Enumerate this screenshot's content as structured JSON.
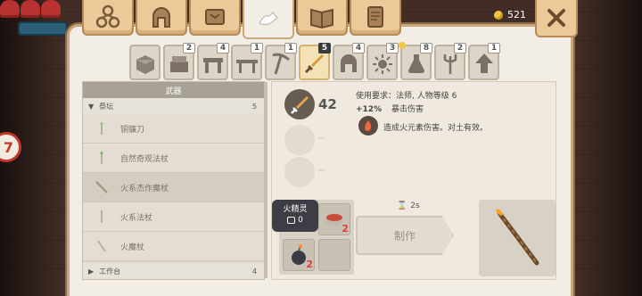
{
  "hud": {
    "badge_text": "7"
  },
  "top_tabs": [
    {
      "id": "structures",
      "icon": "structures-icon",
      "active": false
    },
    {
      "id": "helmet",
      "icon": "helmet-icon",
      "active": false
    },
    {
      "id": "storage",
      "icon": "treasure-map-icon",
      "active": false
    },
    {
      "id": "crafting",
      "icon": "crafting-hands-icon",
      "active": true
    },
    {
      "id": "journal",
      "icon": "book-icon",
      "active": false
    },
    {
      "id": "quests",
      "icon": "scroll-icon",
      "active": false
    }
  ],
  "currency": {
    "amount": "521",
    "icon": "gold-coin-icon"
  },
  "categories": [
    {
      "icon": "block-icon",
      "count": ""
    },
    {
      "icon": "materials-icon",
      "count": "2"
    },
    {
      "icon": "workbench-icon",
      "count": "4"
    },
    {
      "icon": "table-icon",
      "count": "1"
    },
    {
      "icon": "pickaxe-icon",
      "count": "1"
    },
    {
      "icon": "sword-icon",
      "count": "5",
      "active": true
    },
    {
      "icon": "armor-helmet-icon",
      "count": "4"
    },
    {
      "icon": "sun-accessory-icon",
      "count": "3"
    },
    {
      "icon": "potion-icon",
      "count": "8",
      "new": true
    },
    {
      "icon": "trident-icon",
      "count": "2"
    },
    {
      "icon": "upgrade-arrow-icon",
      "count": "1"
    }
  ],
  "recipe_list": {
    "header": "武器",
    "group": {
      "name": "祭坛",
      "count": "5",
      "expanded": true
    },
    "items": [
      {
        "name": "铜镰刀",
        "active": false
      },
      {
        "name": "自然奇观法杖",
        "active": false
      },
      {
        "name": "火系杰作魔杖",
        "active": true
      },
      {
        "name": "火系法杖",
        "active": false
      },
      {
        "name": "火魔杖",
        "active": false
      }
    ],
    "next_group": {
      "name": "工作台",
      "count": "4",
      "expanded": false
    }
  },
  "detail": {
    "damage": "42",
    "requirement": "使用要求：法师, 人物等级 6",
    "crit_value": "+12%",
    "crit_label": "暴击伤害",
    "effect_text": "造成火元素伤害。对土有效。",
    "empty_stat_1": "--",
    "empty_stat_2": "--",
    "ingredients": [
      {
        "name": "fire-spirit",
        "icon": "fire-bomb-icon",
        "need": "2"
      },
      {
        "name": "stew-bowl",
        "icon": "bowl-icon",
        "need": "2"
      }
    ],
    "tooltip": {
      "title": "火精灵",
      "owned": "0"
    },
    "timer": "2s",
    "craft_label": "制作",
    "result_icon": "fire-wand-icon"
  }
}
